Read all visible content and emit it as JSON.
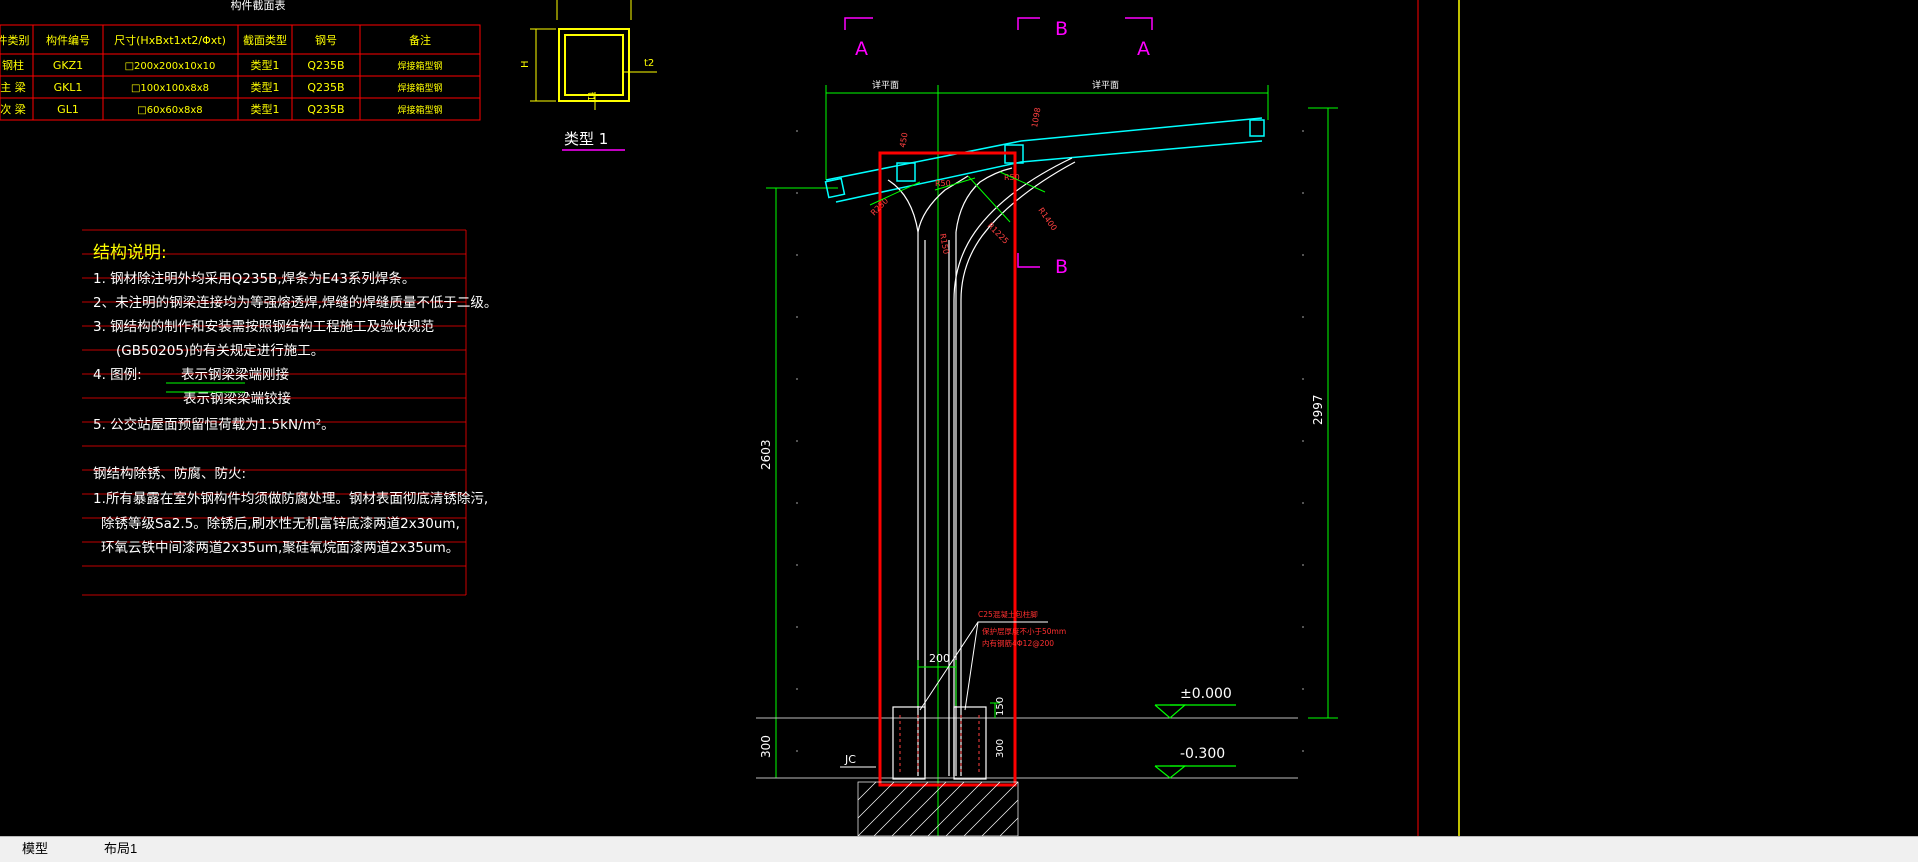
{
  "section_table": {
    "title": "构件截面表",
    "headers": [
      "件类别",
      "构件编号",
      "尺寸(HxBxt1xt2/Φxt)",
      "截面类型",
      "钢号",
      "备注"
    ],
    "rows": [
      [
        "钢柱",
        "GKZ1",
        "□200x200x10x10",
        "类型1",
        "Q235B",
        "焊接箱型钢"
      ],
      [
        "主 梁",
        "GKL1",
        "□100x100x8x8",
        "类型1",
        "Q235B",
        "焊接箱型钢"
      ],
      [
        "次 梁",
        "GL1",
        "□60x60x8x8",
        "类型1",
        "Q235B",
        "焊接箱型钢"
      ]
    ]
  },
  "section_type": {
    "label": "类型 1",
    "dim_h": "H",
    "dim_t2": "t2",
    "dim_t1": "t1"
  },
  "notes": {
    "title": "结构说明:",
    "lines": [
      "1. 钢材除注明外均采用Q235B,焊条为E43系列焊条。",
      "2、未注明的钢梁连接均为等强熔透焊,焊缝的焊缝质量不低于二级。",
      "3. 钢结构的制作和安装需按照钢结构工程施工及验收规范",
      "(GB50205)的有关规定进行施工。",
      "4. 图例:",
      "表示钢梁梁端刚接",
      "表示钢梁梁端铰接",
      "5. 公交站屋面预留恒荷载为1.5kN/m²。"
    ],
    "subtitle": "钢结构除锈、防腐、防火:",
    "sub_lines": [
      "1.所有暴露在室外钢构件均须做防腐处理。钢材表面彻底清锈除污,",
      "除锈等级Sa2.5。除锈后,刷水性无机富锌底漆两道2x30um,",
      "环氧云铁中间漆两道2x35um,聚硅氧烷面漆两道2x35um。"
    ]
  },
  "elevation": {
    "section_marks": [
      "A",
      "B",
      "A",
      "B"
    ],
    "dim_labels": {
      "left_span": "详平面",
      "right_span": "详平面",
      "left_height": "2603",
      "right_height": "2997",
      "base_left": "300",
      "base_right": "300",
      "base_top": "150",
      "width_200": "200",
      "r_left": "R250",
      "r_mid": "R150",
      "r_arc": "R1225",
      "r_top1": "R50",
      "r_top2": "R50",
      "r_1400": "R1400",
      "dim_1098": "1098",
      "dim_450": "450",
      "r_right": "R50"
    },
    "levels": [
      "±0.000",
      "-0.300"
    ],
    "jc": "JC",
    "foundation_note": [
      "C25混凝土包柱脚",
      "保护层厚度不小于50mm",
      "内有钢筋4Φ12@200"
    ]
  },
  "tabs": [
    {
      "label": "模型",
      "active": true
    },
    {
      "label": "布局1",
      "active": false
    }
  ],
  "colors": {
    "background": "#000000",
    "red": "#ff0000",
    "yellow": "#ffff00",
    "green": "#00ff00",
    "cyan": "#00ffff",
    "magenta": "#ff00ff",
    "white": "#ffffff"
  }
}
